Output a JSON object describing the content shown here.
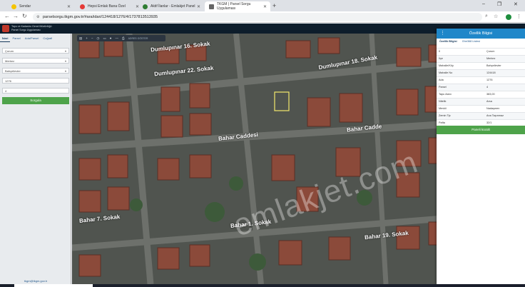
{
  "browser": {
    "tabs": [
      {
        "label": "Sendar",
        "fav_color": "#f5c400"
      },
      {
        "label": "Hepsi Emlak Bana Özel",
        "fav_color": "#e53935"
      },
      {
        "label": "Aktif İlanlar - Emlakjet Panel",
        "fav_color": "#2e7d32"
      },
      {
        "label": "TKGM | Parsel Sorgu Uygulaması",
        "fav_color": "#ffffff"
      }
    ],
    "url": "parselsorgu.tkgm.gov.tr/#ara/idari/124418/1276/4/1737813513935"
  },
  "app": {
    "title_line1": "Tapu ve Kadastro Genel Müdürlüğü",
    "title_line2": "Parsel Sorgu Uygulaması"
  },
  "sidebar": {
    "tabs": [
      "İdari",
      "Parsel",
      "Ada/Parsel",
      "Coğrafi"
    ],
    "il": "Çorum",
    "ilce": "Merkez",
    "mahalle": "Bahçelievler",
    "ada": "1276",
    "parsel": "4",
    "sorgula_label": "Sorgula",
    "footer": "tkgm@tkgm.gov.tr"
  },
  "map": {
    "toolbar_text": "ADRES GÖSTER",
    "roads": [
      "Dumlupınar 16. Sokak",
      "Dumlupınar 22. Sokak",
      "Dumlupınar 18. Sokak",
      "Bahar Caddesi",
      "Bahar Cadde",
      "Bahar 1. Sokak",
      "Bahar 19. Sokak",
      "Bahar 7. Sokak"
    ],
    "watermark": "emlakjet.com"
  },
  "panel": {
    "title": "Özellik Bilgisi",
    "tabs": [
      "Özellik Bilgisi",
      "Ghe368 Listesi"
    ],
    "rows": [
      {
        "k": "İl",
        "v": "Çorum"
      },
      {
        "k": "İlçe",
        "v": "Merkez"
      },
      {
        "k": "Mahalle/Köy",
        "v": "Bahçelievler"
      },
      {
        "k": "Mahalle No",
        "v": "124418"
      },
      {
        "k": "Ada",
        "v": "1276"
      },
      {
        "k": "Parsel",
        "v": "4"
      },
      {
        "k": "Tapu Alanı",
        "v": "383,00"
      },
      {
        "k": "Nitelik",
        "v": "Arsa"
      },
      {
        "k": "Mevkii",
        "v": "Nadaşmen"
      },
      {
        "k": "Zemin Tip",
        "v": "Ana Taşınmaz"
      },
      {
        "k": "Pafta",
        "v": "32/1"
      }
    ],
    "button_label": "Paneli kücült"
  }
}
